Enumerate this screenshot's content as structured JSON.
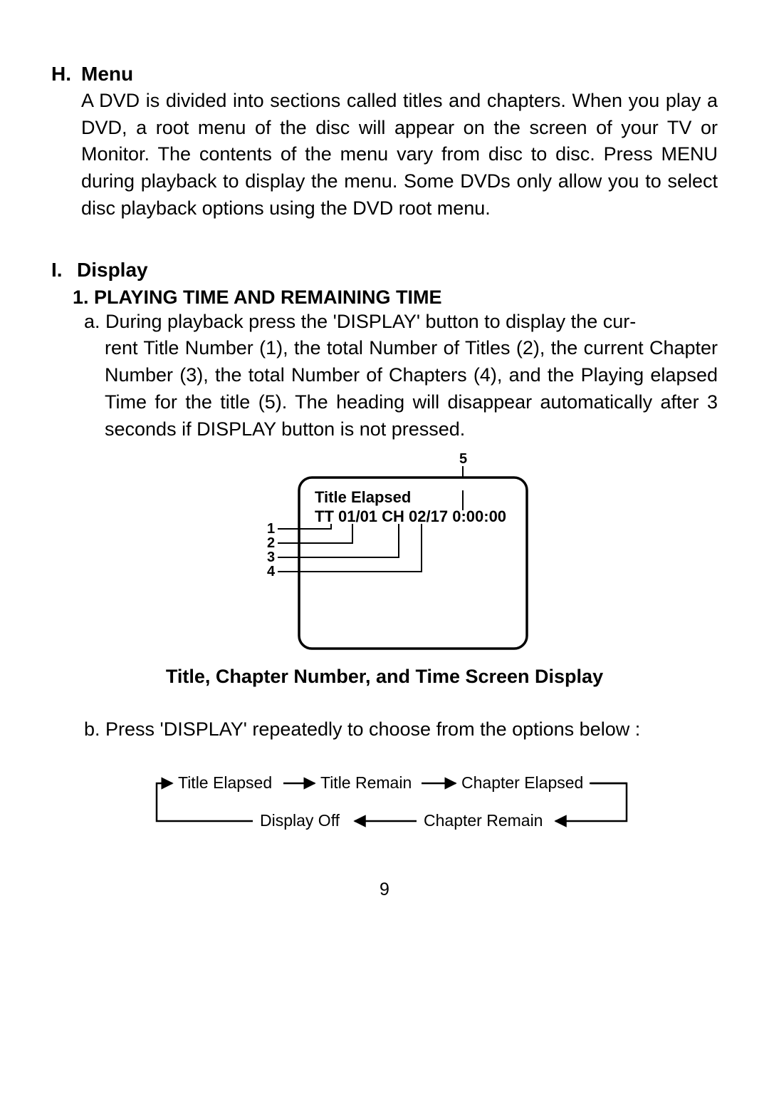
{
  "secH": {
    "letter": "H.",
    "title": "Menu",
    "para": "A DVD is divided into sections called titles and chapters. When you play a DVD, a root menu of the disc will appear on the screen of your TV or Monitor. The contents of the menu vary from disc to disc. Press MENU during playback to display the menu. Some DVDs only allow you to select disc playback options using the DVD root menu."
  },
  "secI": {
    "letter": "I.",
    "title": "Display",
    "sub1": "1. PLAYING TIME AND REMAINING TIME",
    "a_first": "a. During playback press the 'DISPLAY'  button to display the cur-",
    "a_rest": "rent  Title Number (1), the total Number of Titles (2), the current Chapter Number (3), the total Number of Chapters (4), and the Playing  elapsed Time for the title (5). The heading will disappear automatically after 3 seconds if DISPLAY button is not pressed.",
    "b": "b. Press 'DISPLAY' repeatedly  to choose from the options below :"
  },
  "diagram": {
    "header": "Title Elapsed",
    "line2": "TT 01/01  CH 02/17  0:00:00",
    "labels": {
      "n1": "1",
      "n2": "2",
      "n3": "3",
      "n4": "4",
      "n5": "5"
    },
    "caption": "Title, Chapter Number, and Time Screen Display"
  },
  "flow": {
    "te": "Title Elapsed",
    "tr": "Title Remain",
    "ce": "Chapter Elapsed",
    "cr": "Chapter Remain",
    "off": "Display Off"
  },
  "pageNo": "9"
}
